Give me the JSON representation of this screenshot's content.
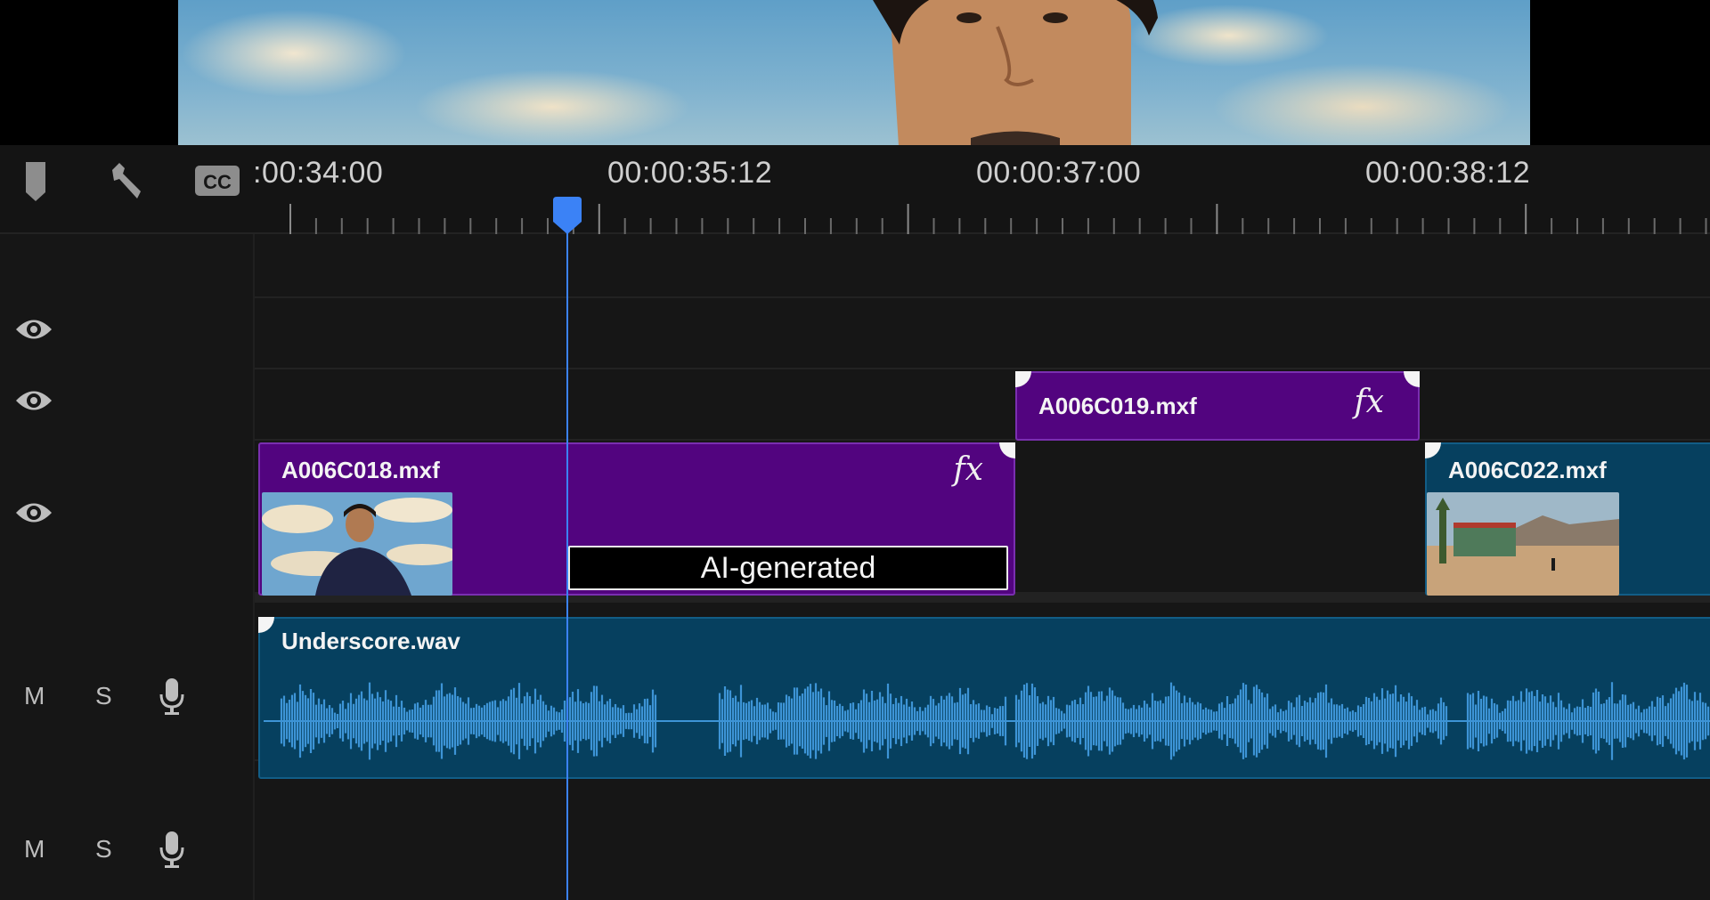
{
  "ruler": {
    "timecodes": [
      ":00:34:00",
      "00:00:35:12",
      "00:00:37:00",
      "00:00:38:12"
    ]
  },
  "icons": {
    "marker": "marker-icon",
    "wrench": "wrench-icon",
    "captions": "closed-captions-icon",
    "eye": "eye-icon",
    "mic": "microphone-icon",
    "fx": "fx-icon"
  },
  "audio_tracks": [
    {
      "mute": "M",
      "solo": "S"
    },
    {
      "mute": "M",
      "solo": "S"
    }
  ],
  "clips": {
    "a006c018": {
      "name": "A006C018.mxf",
      "fx": "fx"
    },
    "a006c019": {
      "name": "A006C019.mxf",
      "fx": "fx"
    },
    "a006c022": {
      "name": "A006C022.mxf"
    },
    "underscore": {
      "name": "Underscore.wav"
    }
  },
  "ai_badge": {
    "label": "AI-generated"
  },
  "colors": {
    "video_clip": "#52047f",
    "audio_clip": "#06405f",
    "playhead": "#3b82f6",
    "waveform": "#3d94d6"
  }
}
